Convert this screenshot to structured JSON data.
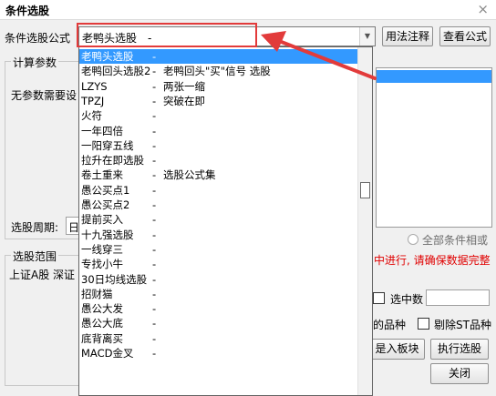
{
  "window": {
    "title": "条件选股",
    "close_glyph": "×"
  },
  "formula": {
    "label": "条件选股公式",
    "selected": "老鸭头选股　-",
    "btn_usage": "用法注释",
    "btn_view": "查看公式"
  },
  "params": {
    "group_title": "计算参数",
    "no_param_text": "无参数需要设",
    "period_label": "选股周期:",
    "period_value": "日"
  },
  "range": {
    "group_title": "选股范围",
    "markets_text": "上证A股  深证"
  },
  "options": {
    "all_conditions": "全部条件相或",
    "warning": "中进行, 请确保数据完整",
    "selected_count_label": "选中数",
    "selected_varieties_label": "的品种",
    "exclude_st_label": "剔除ST品种",
    "join_block_btn": "是入板块",
    "execute_btn": "执行选股",
    "close_btn": "关闭"
  },
  "dropdown": {
    "items": [
      {
        "name": "老鸭头选股",
        "sep": "-",
        "desc": "",
        "selected": true
      },
      {
        "name": "老鸭回头选股2",
        "sep": "-",
        "desc": "老鸭回头\"买\"信号 选股"
      },
      {
        "name": "LZYS",
        "sep": "-",
        "desc": "两张一缩"
      },
      {
        "name": "TPZJ",
        "sep": "-",
        "desc": "突破在即"
      },
      {
        "name": "火符",
        "sep": "-",
        "desc": ""
      },
      {
        "name": "一年四倍",
        "sep": "-",
        "desc": ""
      },
      {
        "name": "一阳穿五线",
        "sep": "-",
        "desc": ""
      },
      {
        "name": "拉升在即选股",
        "sep": "-",
        "desc": ""
      },
      {
        "name": "卷土重来",
        "sep": "-",
        "desc": "选股公式集"
      },
      {
        "name": "愚公买点1",
        "sep": "-",
        "desc": ""
      },
      {
        "name": "愚公买点2",
        "sep": "-",
        "desc": ""
      },
      {
        "name": "提前买入",
        "sep": "-",
        "desc": ""
      },
      {
        "name": "十九强选股",
        "sep": "-",
        "desc": ""
      },
      {
        "name": "一线穿三",
        "sep": "-",
        "desc": ""
      },
      {
        "name": "专找小牛",
        "sep": "-",
        "desc": ""
      },
      {
        "name": "30日均线选股",
        "sep": "-",
        "desc": ""
      },
      {
        "name": "招财猫",
        "sep": "-",
        "desc": ""
      },
      {
        "name": "愚公大发",
        "sep": "-",
        "desc": ""
      },
      {
        "name": "愚公大底",
        "sep": "-",
        "desc": ""
      },
      {
        "name": "底背离买",
        "sep": "-",
        "desc": ""
      },
      {
        "name": "MACD金叉",
        "sep": "-",
        "desc": ""
      }
    ]
  },
  "colors": {
    "highlight": "#3399ff",
    "annotation_red": "#e23b3b",
    "warning_red": "#e00000"
  }
}
